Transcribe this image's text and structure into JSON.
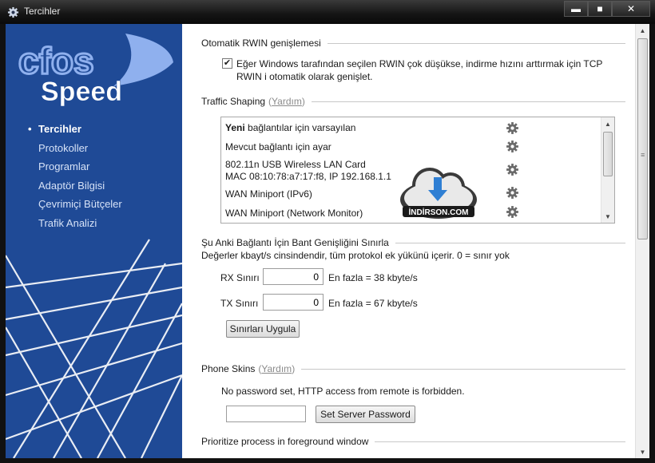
{
  "window": {
    "title": "Tercihler",
    "controls": {
      "minimize": "▬",
      "maximize": "■",
      "close": "✕"
    }
  },
  "sidebar": {
    "logo": {
      "line1": "cfos",
      "line2": "Speed"
    },
    "items": [
      {
        "label": "Tercihler",
        "active": true
      },
      {
        "label": "Protokoller"
      },
      {
        "label": "Programlar"
      },
      {
        "label": "Adaptör Bilgisi"
      },
      {
        "label": "Çevrimiçi Bütçeler"
      },
      {
        "label": "Trafik Analizi"
      }
    ],
    "colors": {
      "background": "#1f4a96",
      "logo": "#8fb0ee"
    }
  },
  "rwin": {
    "heading": "Otomatik RWIN genişlemesi",
    "checkbox_checked": true,
    "checkbox_line1": "Eğer Windows tarafından seçilen RWIN çok düşükse, indirme hızını arttırmak için TCP",
    "checkbox_line2": "RWIN i otomatik olarak genişlet."
  },
  "traffic": {
    "heading": "Traffic Shaping",
    "help_open": "(",
    "help": "Yardım",
    "help_close": ")",
    "items": [
      {
        "bold": "Yeni",
        "rest": " bağlantılar için varsayılan"
      },
      {
        "bold": "",
        "rest": "Mevcut bağlantı için ayar"
      },
      {
        "bold": "",
        "rest": "802.11n USB Wireless LAN Card",
        "line2": "MAC 08:10:78:a7:17:f8, IP 192.168.1.1"
      },
      {
        "bold": "",
        "rest": "WAN Miniport (IPv6)"
      },
      {
        "bold": "",
        "rest": "WAN Miniport (Network Monitor)"
      }
    ],
    "watermark": "İNDİRSON.COM"
  },
  "limits": {
    "heading": "Şu Anki Bağlantı İçin Bant Genişliğini Sınırla",
    "description": "Değerler kbayt/s cinsindendir, tüm protokol ek yükünü içerir. 0 = sınır yok",
    "rx_label": "RX Sınırı",
    "rx_value": "0",
    "rx_max": "En fazla = 38 kbyte/s",
    "tx_label": "TX Sınırı",
    "tx_value": "0",
    "tx_max": "En fazla = 67 kbyte/s",
    "apply_button": "Sınırları Uygula"
  },
  "phone": {
    "heading": "Phone Skins",
    "help_open": "(",
    "help": "Yardım",
    "help_close": ")",
    "status": "No password set, HTTP access from remote is forbidden.",
    "password_value": "",
    "set_button": "Set Server Password"
  },
  "foreground": {
    "heading": "Prioritize process in foreground window"
  }
}
